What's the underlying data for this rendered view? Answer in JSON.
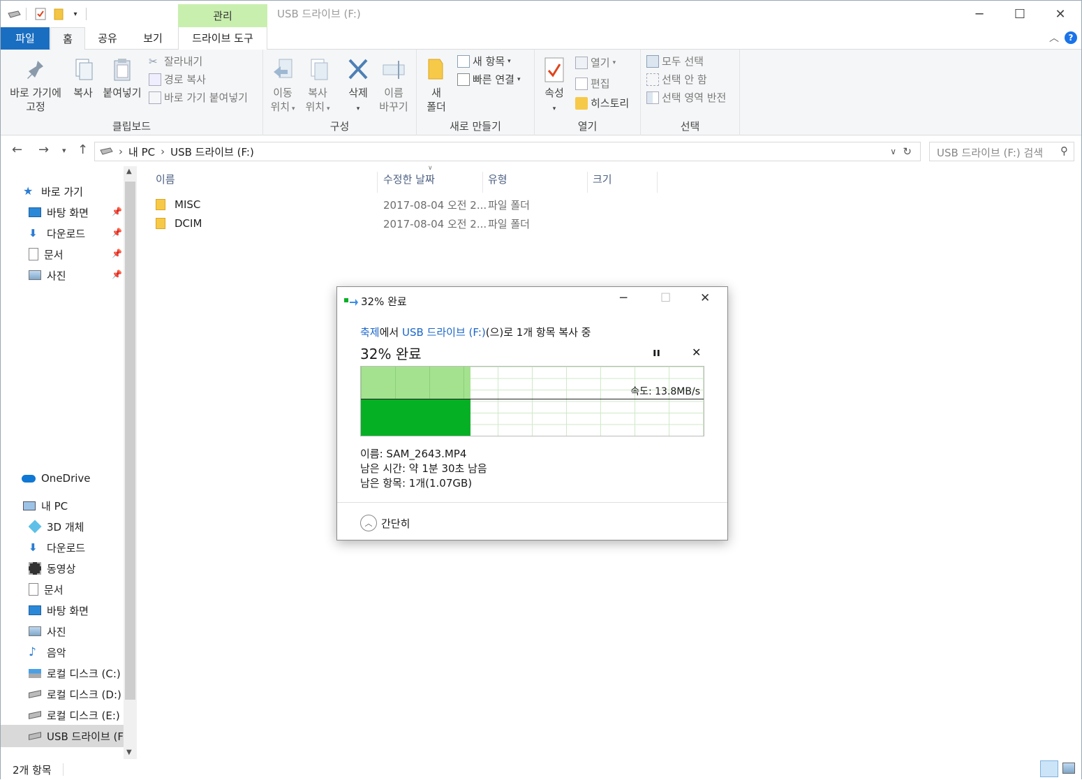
{
  "titlebar": {
    "manage_tab": "관리",
    "title": "USB 드라이브 (F:)"
  },
  "tabs": {
    "file": "파일",
    "home": "홈",
    "share": "공유",
    "view": "보기",
    "drive_tools": "드라이브 도구"
  },
  "ribbon": {
    "clipboard": {
      "label": "클립보드",
      "pin_quick_line1": "바로 가기에",
      "pin_quick_line2": "고정",
      "copy": "복사",
      "paste": "붙여넣기",
      "cut": "잘라내기",
      "copy_path": "경로 복사",
      "paste_shortcut": "바로 가기 붙여넣기"
    },
    "organize": {
      "label": "구성",
      "move_to_line1": "이동",
      "move_to_line2": "위치",
      "copy_to_line1": "복사",
      "copy_to_line2": "위치",
      "delete": "삭제",
      "rename_line1": "이름",
      "rename_line2": "바꾸기"
    },
    "new": {
      "label": "새로 만들기",
      "new_folder_line1": "새",
      "new_folder_line2": "폴더",
      "new_item": "새 항목",
      "easy_access": "빠른 연결"
    },
    "open": {
      "label": "열기",
      "properties": "속성",
      "open": "열기",
      "edit": "편집",
      "history": "히스토리"
    },
    "select": {
      "label": "선택",
      "select_all": "모두 선택",
      "select_none": "선택 안 함",
      "invert": "선택 영역 반전"
    }
  },
  "address": {
    "crumbs": [
      "내 PC",
      "USB 드라이브 (F:)"
    ],
    "search_placeholder": "USB 드라이브 (F:) 검색"
  },
  "nav": {
    "quick_access": "바로 가기",
    "quick_items": [
      {
        "label": "바탕 화면",
        "icon": "desktop-icon"
      },
      {
        "label": "다운로드",
        "icon": "download-icon"
      },
      {
        "label": "문서",
        "icon": "document-icon"
      },
      {
        "label": "사진",
        "icon": "pictures-icon"
      }
    ],
    "onedrive": "OneDrive",
    "this_pc": "내 PC",
    "pc_items": [
      {
        "label": "3D 개체",
        "icon": "3d-objects-icon"
      },
      {
        "label": "다운로드",
        "icon": "download-icon"
      },
      {
        "label": "동영상",
        "icon": "videos-icon"
      },
      {
        "label": "문서",
        "icon": "document-icon"
      },
      {
        "label": "바탕 화면",
        "icon": "desktop-icon"
      },
      {
        "label": "사진",
        "icon": "pictures-icon"
      },
      {
        "label": "음악",
        "icon": "music-icon"
      },
      {
        "label": "로컬 디스크 (C:)",
        "icon": "windows-drive-icon"
      },
      {
        "label": "로컬 디스크 (D:)",
        "icon": "drive-icon"
      },
      {
        "label": "로컬 디스크 (E:)",
        "icon": "drive-icon"
      },
      {
        "label": "USB 드라이브 (F:)",
        "icon": "usb-drive-icon"
      }
    ]
  },
  "columns": {
    "name": "이름",
    "date": "수정한 날짜",
    "type": "유형",
    "size": "크기"
  },
  "files": [
    {
      "name": "MISC",
      "date": "2017-08-04 오전 2...",
      "type": "파일 폴더",
      "size": ""
    },
    {
      "name": "DCIM",
      "date": "2017-08-04 오전 2...",
      "type": "파일 폴더",
      "size": ""
    }
  ],
  "status": {
    "count": "2개 항목"
  },
  "dialog": {
    "title": "32% 완료",
    "source": "축제",
    "from_suffix": "에서 ",
    "dest": "USB 드라이브 (F:)",
    "action": "(으)로 1개 항목 복사 중",
    "percent_text": "32% 완료",
    "progress": 0.32,
    "speed": "속도: 13.8MB/s",
    "name_line": "이름: SAM_2643.MP4",
    "time_line": "남은 시간: 약 1분 30초 남음",
    "items_line": "남은 항목: 1개(1.07GB)",
    "fewer": "간단히"
  },
  "colors": {
    "accent": "#1a6ec1",
    "manage_tab": "#c9efaf",
    "progress_dark": "#06b025",
    "progress_light": "#a4e28f",
    "link": "#1a66c9"
  }
}
